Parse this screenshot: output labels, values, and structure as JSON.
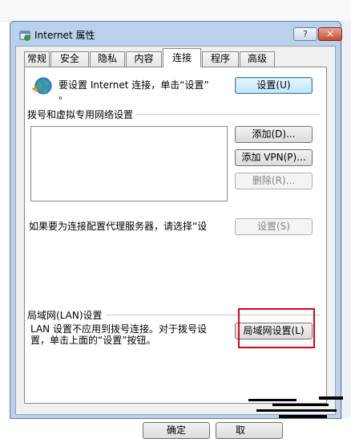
{
  "window": {
    "title": "Internet 属性",
    "help_label": "?",
    "close_label": "✕"
  },
  "tabs": [
    {
      "label": "常规",
      "active": false
    },
    {
      "label": "安全",
      "active": false
    },
    {
      "label": "隐私",
      "active": false
    },
    {
      "label": "内容",
      "active": false
    },
    {
      "label": "连接",
      "active": true
    },
    {
      "label": "程序",
      "active": false
    },
    {
      "label": "高级",
      "active": false
    }
  ],
  "connection": {
    "setup_text": "要设置 Internet 连接，单击“设置”",
    "setup_text_cont": "。",
    "setup_button": "设置(U)"
  },
  "dialup": {
    "heading": "拨号和虚拟专用网络设置",
    "add_button": "添加(D)...",
    "add_vpn_button": "添加 VPN(P)...",
    "remove_button": "删除(R)...",
    "settings_button": "设置(S)",
    "proxy_text": "如果要为连接配置代理服务器，请选择“设"
  },
  "lan": {
    "heading": "局域网(LAN)设置",
    "text_line1": "LAN 设置不应用到拨号连接。对于拨号设",
    "text_line2": "置，单击上面的“设置”按钮。",
    "lan_button": "局域网设置(L)"
  },
  "footer": {
    "ok_button": "确定",
    "cancel_button": "取"
  },
  "colors": {
    "highlight": "#e0001b",
    "title_bar": "#b9d1ea"
  },
  "icons": {
    "globe": "globe-icon"
  }
}
